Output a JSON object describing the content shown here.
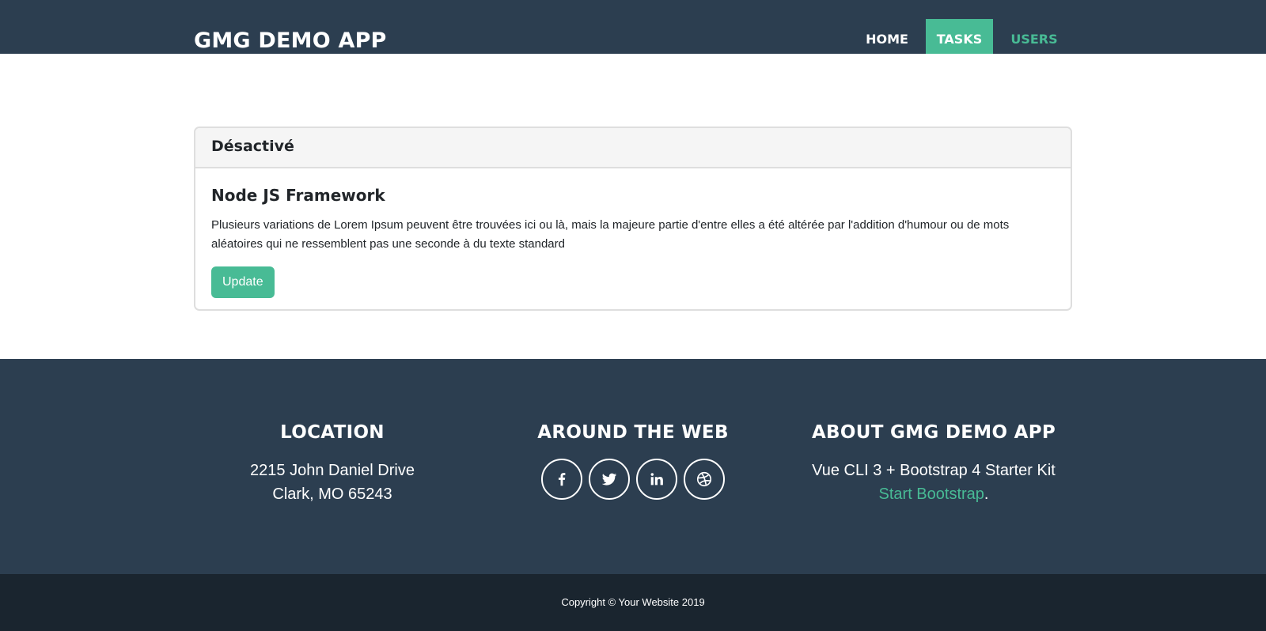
{
  "navbar": {
    "brand": "GMG DEMO APP",
    "items": [
      {
        "label": "HOME"
      },
      {
        "label": "TASKS"
      },
      {
        "label": "USERS"
      }
    ]
  },
  "card": {
    "header": "Désactivé",
    "title": "Node JS Framework",
    "text": "Plusieurs variations de Lorem Ipsum peuvent être trouvées ici ou là, mais la majeure partie d'entre elles a été altérée par l'addition d'humour ou de mots aléatoires qui ne ressemblent pas une seconde à du texte standard",
    "button_label": "Update"
  },
  "footer": {
    "location": {
      "title": "LOCATION",
      "line1": "2215 John Daniel Drive",
      "line2": "Clark, MO 65243"
    },
    "web": {
      "title": "AROUND THE WEB",
      "icons": [
        "facebook-icon",
        "twitter-icon",
        "linkedin-icon",
        "dribbble-icon"
      ]
    },
    "about": {
      "title": "ABOUT GMG DEMO APP",
      "line1": "Vue CLI 3 + Bootstrap 4 Starter Kit",
      "link": "Start Bootstrap",
      "suffix": "."
    },
    "copyright": "Copyright © Your Website 2019"
  },
  "colors": {
    "navbar": "#2c3e50",
    "accent": "#48bb95",
    "copyright_bar": "#1a252f"
  }
}
